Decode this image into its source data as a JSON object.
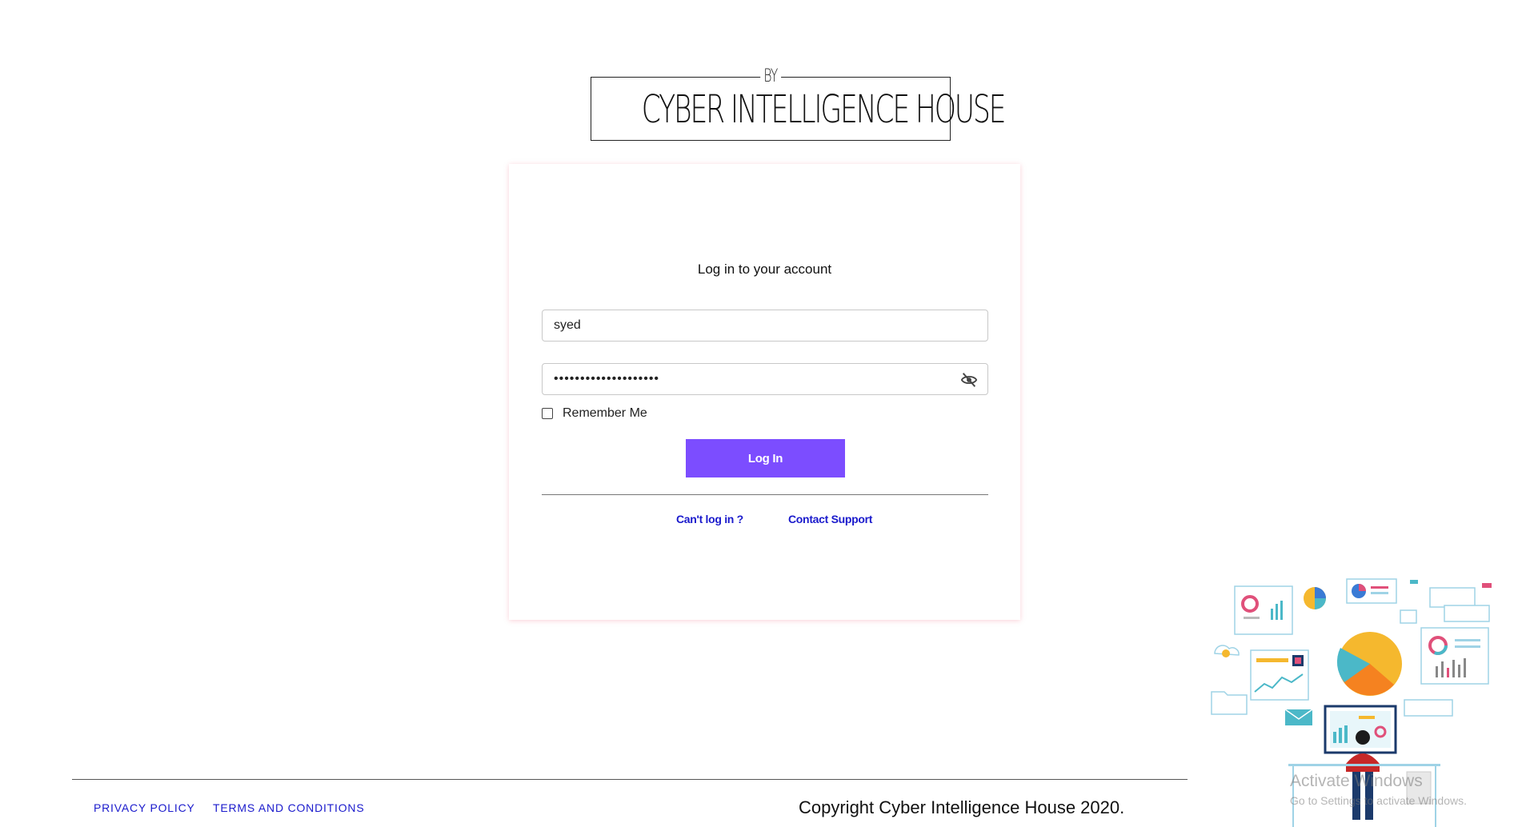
{
  "logo": {
    "by": "BY",
    "name": "CYBER INTELLIGENCE HOUSE"
  },
  "login": {
    "title": "Log in to your account",
    "username_value": "syed",
    "password_masked": "••••••••••••••••••••",
    "remember_label": "Remember Me",
    "remember_checked": false,
    "submit_label": "Log In",
    "cant_login_label": "Can't log in ?",
    "support_label": "Contact Support"
  },
  "footer": {
    "privacy_label": "PRIVACY POLICY",
    "terms_label": "TERMS AND CONDITIONS",
    "copyright": "Copyright Cyber Intelligence House 2020."
  },
  "watermark": {
    "title": "Activate Windows",
    "subtitle": "Go to Settings to activate Windows."
  },
  "colors": {
    "accent": "#7c4dff",
    "link": "#1a1acc"
  },
  "icons": {
    "password_toggle": "eye-off-icon",
    "illustration": "analytics-dashboard-illustration"
  }
}
